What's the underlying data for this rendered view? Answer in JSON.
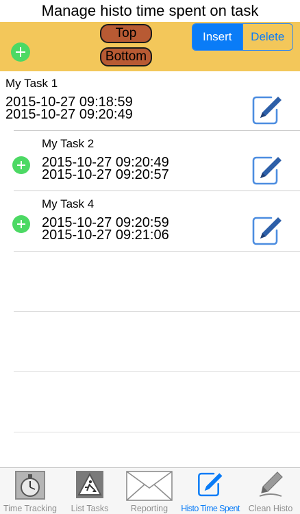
{
  "header": {
    "title": "Manage histo time spent on task"
  },
  "toolbar": {
    "top_label": "Top",
    "bottom_label": "Bottom",
    "segments": {
      "insert": "Insert",
      "delete": "Delete"
    },
    "selected_segment": "Insert"
  },
  "tasks": [
    {
      "name": "My Task 1",
      "start": "2015-10-27 09:18:59",
      "end": "2015-10-27 09:20:49",
      "has_add": false
    },
    {
      "name": "My Task 2",
      "start": "2015-10-27 09:20:49",
      "end": "2015-10-27 09:20:57",
      "has_add": true
    },
    {
      "name": "My Task 4",
      "start": "2015-10-27 09:20:59",
      "end": "2015-10-27 09:21:06",
      "has_add": true
    }
  ],
  "tabs": [
    {
      "label": "Time Tracking",
      "icon": "stopwatch-icon"
    },
    {
      "label": "List Tasks",
      "icon": "road-sign-icon"
    },
    {
      "label": "Reporting",
      "icon": "envelope-icon"
    },
    {
      "label": "Histo Time Spent",
      "icon": "edit-icon",
      "selected": true
    },
    {
      "label": "Clean Histo",
      "icon": "pencil-icon"
    }
  ],
  "colors": {
    "toolbar_bg": "#f3c75a",
    "pill_bg": "#b85a33",
    "accent_blue": "#0a7cf7",
    "add_green": "#4cd964",
    "edit_icon_blue": "#2d5fa8"
  }
}
